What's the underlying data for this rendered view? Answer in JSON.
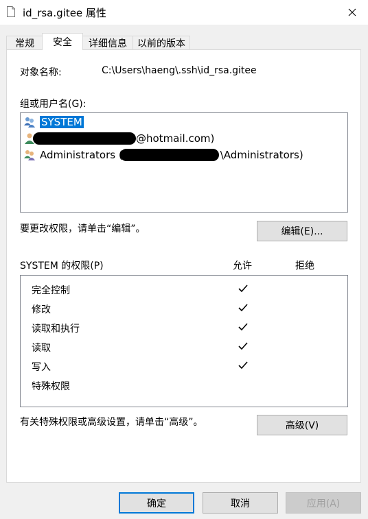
{
  "window": {
    "title": "id_rsa.gitee 属性",
    "close_icon": "close-icon"
  },
  "tabs": [
    {
      "label": "常规",
      "active": false
    },
    {
      "label": "安全",
      "active": true
    },
    {
      "label": "详细信息",
      "active": false
    },
    {
      "label": "以前的版本",
      "active": false
    }
  ],
  "object": {
    "label": "对象名称:",
    "value": "C:\\Users\\haeng\\.ssh\\id_rsa.gitee"
  },
  "groups": {
    "label": "组或用户名(G):",
    "items": [
      {
        "text": "SYSTEM",
        "icon": "group-users-icon",
        "selected": true
      },
      {
        "text": "@hotmail.com)",
        "icon": "user-icon",
        "selected": false
      },
      {
        "text": "Administrators (",
        "suffix": "\\Administrators)",
        "icon": "group-users-icon",
        "selected": false
      }
    ]
  },
  "edit": {
    "hint": "要更改权限，请单击“编辑”。",
    "button": "编辑(E)..."
  },
  "permissions": {
    "label": "SYSTEM 的权限(P)",
    "allow_header": "允许",
    "deny_header": "拒绝",
    "rows": [
      {
        "name": "完全控制",
        "allow": true,
        "deny": false
      },
      {
        "name": "修改",
        "allow": true,
        "deny": false
      },
      {
        "name": "读取和执行",
        "allow": true,
        "deny": false
      },
      {
        "name": "读取",
        "allow": true,
        "deny": false
      },
      {
        "name": "写入",
        "allow": true,
        "deny": false
      },
      {
        "name": "特殊权限",
        "allow": false,
        "deny": false
      }
    ]
  },
  "advanced": {
    "hint": "有关特殊权限或高级设置，请单击“高级”。",
    "button": "高级(V)"
  },
  "footer": {
    "ok": "确定",
    "cancel": "取消",
    "apply": "应用(A)"
  }
}
